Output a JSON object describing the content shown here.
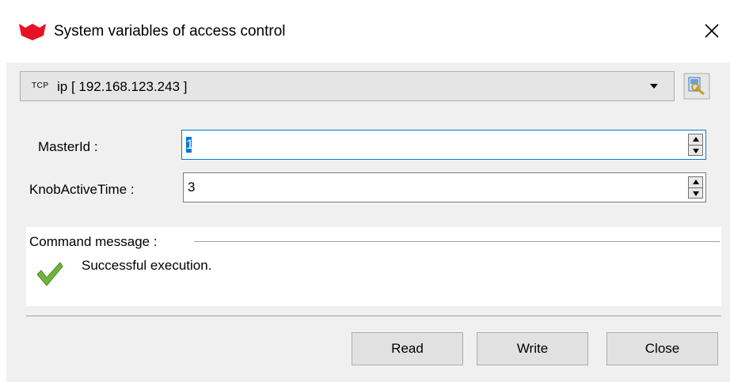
{
  "window": {
    "title": "System variables of access control",
    "icons": {
      "logo": "red-cat-logo-icon",
      "close": "close-icon"
    }
  },
  "connection": {
    "protocol_badge": "TCP",
    "value": "ip [ 192.168.123.243 ]",
    "icons": {
      "dropdown": "chevron-down-icon",
      "settings": "connection-settings-icon"
    }
  },
  "fields": [
    {
      "label": "MasterId :",
      "value": "1",
      "selected": true
    },
    {
      "label": "KnobActiveTime :",
      "value": "3",
      "selected": false
    }
  ],
  "command_message": {
    "title": "Command message :",
    "text": "Successful execution.",
    "status_icon": "checkmark-icon"
  },
  "buttons": {
    "read": "Read",
    "write": "Write",
    "close": "Close"
  },
  "colors": {
    "accent": "#0078d7",
    "logo_red": "#e81123",
    "check_green": "#6fb43f"
  }
}
